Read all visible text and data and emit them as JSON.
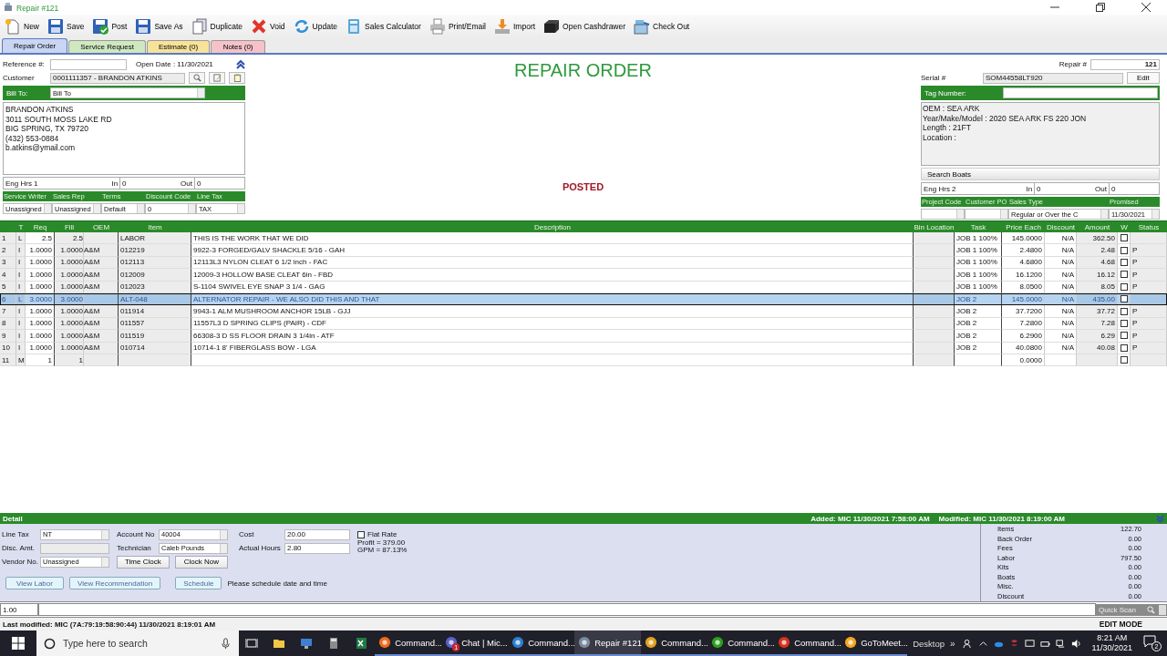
{
  "window": {
    "title": "Repair #121"
  },
  "toolbar": [
    {
      "label": "New"
    },
    {
      "label": "Save"
    },
    {
      "label": "Post"
    },
    {
      "label": "Save As"
    },
    {
      "label": "Duplicate"
    },
    {
      "label": "Void"
    },
    {
      "label": "Update"
    },
    {
      "label": "Sales Calculator"
    },
    {
      "label": "Print/Email"
    },
    {
      "label": "Import"
    },
    {
      "label": "Open Cashdrawer"
    },
    {
      "label": "Check Out"
    }
  ],
  "tabs": [
    {
      "label": "Repair Order",
      "selected": true,
      "color": "#c9d5f2"
    },
    {
      "label": "Service Request",
      "selected": false,
      "color": "#cfe8c0"
    },
    {
      "label": "Estimate (0)",
      "selected": false,
      "color": "#f7e29a"
    },
    {
      "label": "Notes (0)",
      "selected": false,
      "color": "#f4c2c8"
    }
  ],
  "header": {
    "reference_label": "Reference #:",
    "open_date": "Open Date : 11/30/2021",
    "customer_label": "Customer",
    "customer": "0001111357 - BRANDON ATKINS",
    "bill_to_label": "Bill To:",
    "bill_to": "Bill To",
    "address": [
      "BRANDON ATKINS",
      "3011 SOUTH MOSS LAKE RD",
      "BIG SPRING, TX  79720",
      "(432) 553-0884",
      "b.atkins@ymail.com"
    ],
    "eng_hrs_1": {
      "label": "Eng Hrs 1",
      "in_label": "In",
      "in": "0",
      "out_label": "Out",
      "out": "0"
    },
    "left_fields": [
      {
        "label": "Service Writer",
        "value": "Unassigned"
      },
      {
        "label": "Sales Rep",
        "value": "Unassigned"
      },
      {
        "label": "Terms",
        "value": "Default"
      },
      {
        "label": "Discount Code",
        "value": "0"
      },
      {
        "label": "Line Tax",
        "value": "TAX"
      }
    ],
    "title": "REPAIR ORDER",
    "status": "POSTED",
    "repair_label": "Repair #",
    "repair_number": "121",
    "serial_label": "Serial #",
    "serial": "SOM44558LT920",
    "edit_button": "Edit",
    "tag_label": "Tag Number:",
    "boat_info": [
      "OEM : SEA ARK",
      "Year/Make/Model : 2020 SEA ARK FS 220 JON",
      "Length : 21FT",
      "Location :"
    ],
    "search_boats": "Search Boats",
    "eng_hrs_2": {
      "label": "Eng Hrs 2",
      "in_label": "In",
      "in": "0",
      "out_label": "Out",
      "out": "0"
    },
    "right_fields": [
      {
        "label": "Project Code"
      },
      {
        "label": "Customer PO"
      },
      {
        "label": "Sales Type",
        "value": "Regular or Over the C"
      },
      {
        "label": "Promised",
        "value": "11/30/2021"
      }
    ]
  },
  "table": {
    "columns": [
      "T",
      "Req",
      "Fill",
      "OEM",
      "Item",
      "Description",
      "Bin Location",
      "Task",
      "Price Each",
      "Discount",
      "Amount",
      "W",
      "Status"
    ],
    "rows": [
      {
        "n": "1",
        "t": "L",
        "req": "2.5",
        "fill": "2.5",
        "item": "LABOR",
        "description": "THIS IS THE WORK THAT WE DID",
        "task": "JOB 1 100%",
        "price": "145.0000",
        "discount": "N/A",
        "amount": "362.50",
        "w": false,
        "selected": false
      },
      {
        "n": "2",
        "t": "I",
        "req": "1.0000",
        "fill": "1.0000",
        "oem": "A&M",
        "item": "012219",
        "description": "9922-3 FORGED/GALV SHACKLE 5/16 - GAH",
        "task": "JOB 1 100%",
        "price": "2.4800",
        "discount": "N/A",
        "amount": "2.48",
        "w": false,
        "status": "P",
        "selected": false
      },
      {
        "n": "3",
        "t": "I",
        "req": "1.0000",
        "fill": "1.0000",
        "oem": "A&M",
        "item": "012113",
        "description": "12113L3 NYLON CLEAT 6 1/2 inch - FAC",
        "task": "JOB 1 100%",
        "price": "4.6800",
        "discount": "N/A",
        "amount": "4.68",
        "w": false,
        "status": "P",
        "selected": false
      },
      {
        "n": "4",
        "t": "I",
        "req": "1.0000",
        "fill": "1.0000",
        "oem": "A&M",
        "item": "012009",
        "description": "12009-3 HOLLOW BASE CLEAT 6in - FBD",
        "task": "JOB 1 100%",
        "price": "16.1200",
        "discount": "N/A",
        "amount": "16.12",
        "w": false,
        "status": "P",
        "selected": false
      },
      {
        "n": "5",
        "t": "I",
        "req": "1.0000",
        "fill": "1.0000",
        "oem": "A&M",
        "item": "012023",
        "description": "S-1104  SWIVEL EYE SNAP 3 1/4 - GAG",
        "task": "JOB 1 100%",
        "price": "8.0500",
        "discount": "N/A",
        "amount": "8.05",
        "w": false,
        "status": "P",
        "selected": false
      },
      {
        "n": "6",
        "t": "L",
        "req": "3.0000",
        "fill": "3.0000",
        "item": "ALT-048",
        "description": "ALTERNATOR  REPAIR - WE ALSO DID THIS AND THAT",
        "task": "JOB 2",
        "price": "145.0000",
        "discount": "N/A",
        "amount": "435.00",
        "w": false,
        "selected": true
      },
      {
        "n": "7",
        "t": "I",
        "req": "1.0000",
        "fill": "1.0000",
        "oem": "A&M",
        "item": "011914",
        "description": "9943-1 ALM MUSHROOM ANCHOR 15LB - GJJ",
        "task": "JOB 2",
        "price": "37.7200",
        "discount": "N/A",
        "amount": "37.72",
        "w": false,
        "status": "P",
        "selected": false
      },
      {
        "n": "8",
        "t": "I",
        "req": "1.0000",
        "fill": "1.0000",
        "oem": "A&M",
        "item": "011557",
        "description": "11557L3 D SPRING CLIPS (PAIR) - CDF",
        "task": "JOB 2",
        "price": "7.2800",
        "discount": "N/A",
        "amount": "7.28",
        "w": false,
        "status": "P",
        "selected": false
      },
      {
        "n": "9",
        "t": "I",
        "req": "1.0000",
        "fill": "1.0000",
        "oem": "A&M",
        "item": "011519",
        "description": "66308-3 D SS FLOOR DRAIN 3 1/4in - ATF",
        "task": "JOB 2",
        "price": "6.2900",
        "discount": "N/A",
        "amount": "6.29",
        "w": false,
        "status": "P",
        "selected": false
      },
      {
        "n": "10",
        "t": "I",
        "req": "1.0000",
        "fill": "1.0000",
        "oem": "A&M",
        "item": "010714",
        "description": "10714-1 8' FIBERGLASS BOW - LGA",
        "task": "JOB 2",
        "price": "40.0800",
        "discount": "N/A",
        "amount": "40.08",
        "w": false,
        "status": "P",
        "selected": false
      },
      {
        "n": "11",
        "t": "M",
        "req": "1",
        "fill": "1",
        "price": "0.0000",
        "w": false,
        "selected": false
      }
    ]
  },
  "detail": {
    "title": "Detail",
    "added": "Added: MIC 11/30/2021 7:58:00 AM",
    "modified": "Modified: MIC 11/30/2021 8:19:00 AM",
    "line_tax_label": "Line Tax",
    "line_tax": "NT",
    "disc_amt_label": "Disc. Amt.",
    "vendor_label": "Vendor No.",
    "vendor": "Unassigned",
    "account_label": "Account No",
    "account": "40004",
    "technician_label": "Technician",
    "technician": "Caleb Pounds",
    "cost_label": "Cost",
    "cost": "20.00",
    "hours_label": "Actual Hours",
    "hours": "2.80",
    "flat_rate": {
      "label": "Flat Rate",
      "checked": false
    },
    "profit": "Profit = 379.00",
    "gpm": "GPM = 87.13%",
    "time_clock": "Time Clock",
    "clock_now": "Clock Now",
    "view_labor": "View Labor",
    "view_recommendation": "View Recommendation",
    "schedule": "Schedule",
    "schedule_note": "Please schedule date and time",
    "summary": [
      {
        "label": "Items",
        "value": "122.70"
      },
      {
        "label": "Back Order",
        "value": "0.00"
      },
      {
        "label": "Fees",
        "value": "0.00"
      },
      {
        "label": "Labor",
        "value": "797.50"
      },
      {
        "label": "Kits",
        "value": "0.00"
      },
      {
        "label": "Boats",
        "value": "0.00"
      },
      {
        "label": "Misc.",
        "value": "0.00"
      },
      {
        "label": "Discount",
        "value": "0.00"
      }
    ]
  },
  "entry": {
    "quantity": "1.00",
    "quick_scan": "Quick Scan"
  },
  "status_bar": {
    "last_modified": "Last modified: MIC (7A:79:19:58:90:44) 11/30/2021 8:19:01 AM",
    "mode": "EDIT MODE"
  },
  "taskbar": {
    "search_placeholder": "Type here to search",
    "apps": [
      {
        "label": "Command...",
        "selected": false
      },
      {
        "label": "Chat | Mic...",
        "selected": false,
        "badge": "1"
      },
      {
        "label": "Command...",
        "selected": false
      },
      {
        "label": "Repair #121",
        "selected": true
      },
      {
        "label": "Command...",
        "selected": false
      },
      {
        "label": "Command...",
        "selected": false
      },
      {
        "label": "Command...",
        "selected": false
      },
      {
        "label": "GoToMeet...",
        "selected": false
      }
    ],
    "desktop": "Desktop",
    "overflow": "»",
    "time": "8:21 AM",
    "date": "11/30/2021",
    "notifications": "2"
  }
}
